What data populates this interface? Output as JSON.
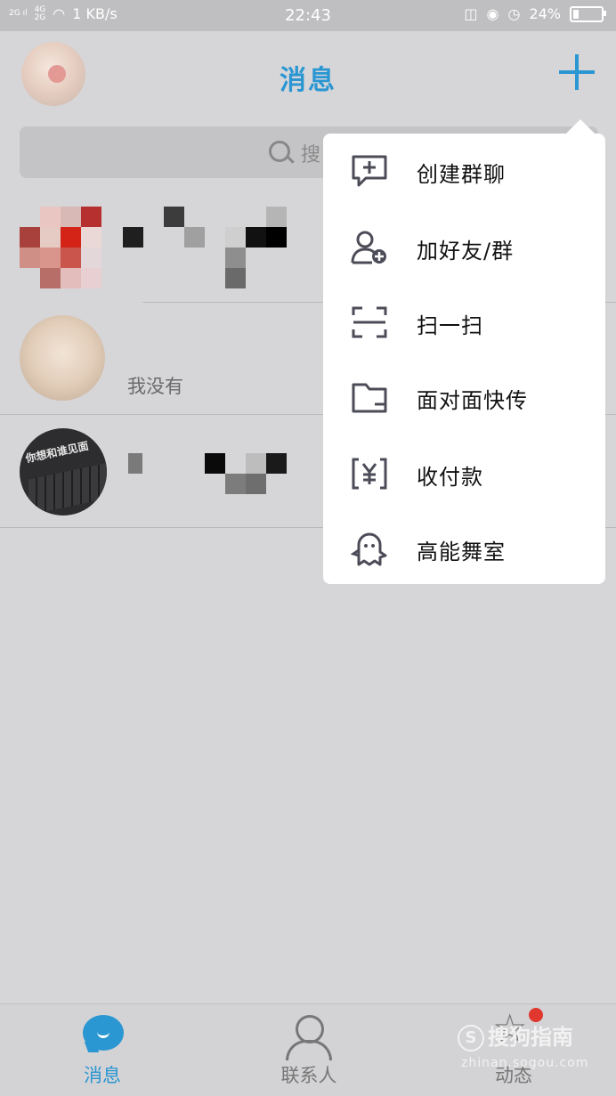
{
  "status_bar": {
    "signal1": "2G",
    "signal2_top": "4G",
    "signal2_bottom": "2G",
    "speed": "1 KB/s",
    "time": "22:43",
    "battery": "24%"
  },
  "header": {
    "title": "消息"
  },
  "search": {
    "placeholder": "搜"
  },
  "chats": [
    {
      "preview": ""
    },
    {
      "preview": "我没有"
    },
    {
      "preview": "",
      "avatar_text": "你想和谁见面"
    }
  ],
  "popup_menu": {
    "items": [
      {
        "label": "创建群聊",
        "icon": "create-group-icon"
      },
      {
        "label": "加好友/群",
        "icon": "add-friend-icon"
      },
      {
        "label": "扫一扫",
        "icon": "scan-icon"
      },
      {
        "label": "面对面快传",
        "icon": "folder-icon"
      },
      {
        "label": "收付款",
        "icon": "payment-icon"
      },
      {
        "label": "高能舞室",
        "icon": "ghost-icon"
      }
    ]
  },
  "bottom_nav": {
    "items": [
      {
        "label": "消息",
        "active": true
      },
      {
        "label": "联系人",
        "active": false
      },
      {
        "label": "动态",
        "active": false
      }
    ]
  },
  "watermark": {
    "logo_text": "搜狗指南",
    "url_text": "zhinan.sogou.com"
  },
  "colors": {
    "accent": "#2a96d2",
    "badge": "#e0372e"
  }
}
